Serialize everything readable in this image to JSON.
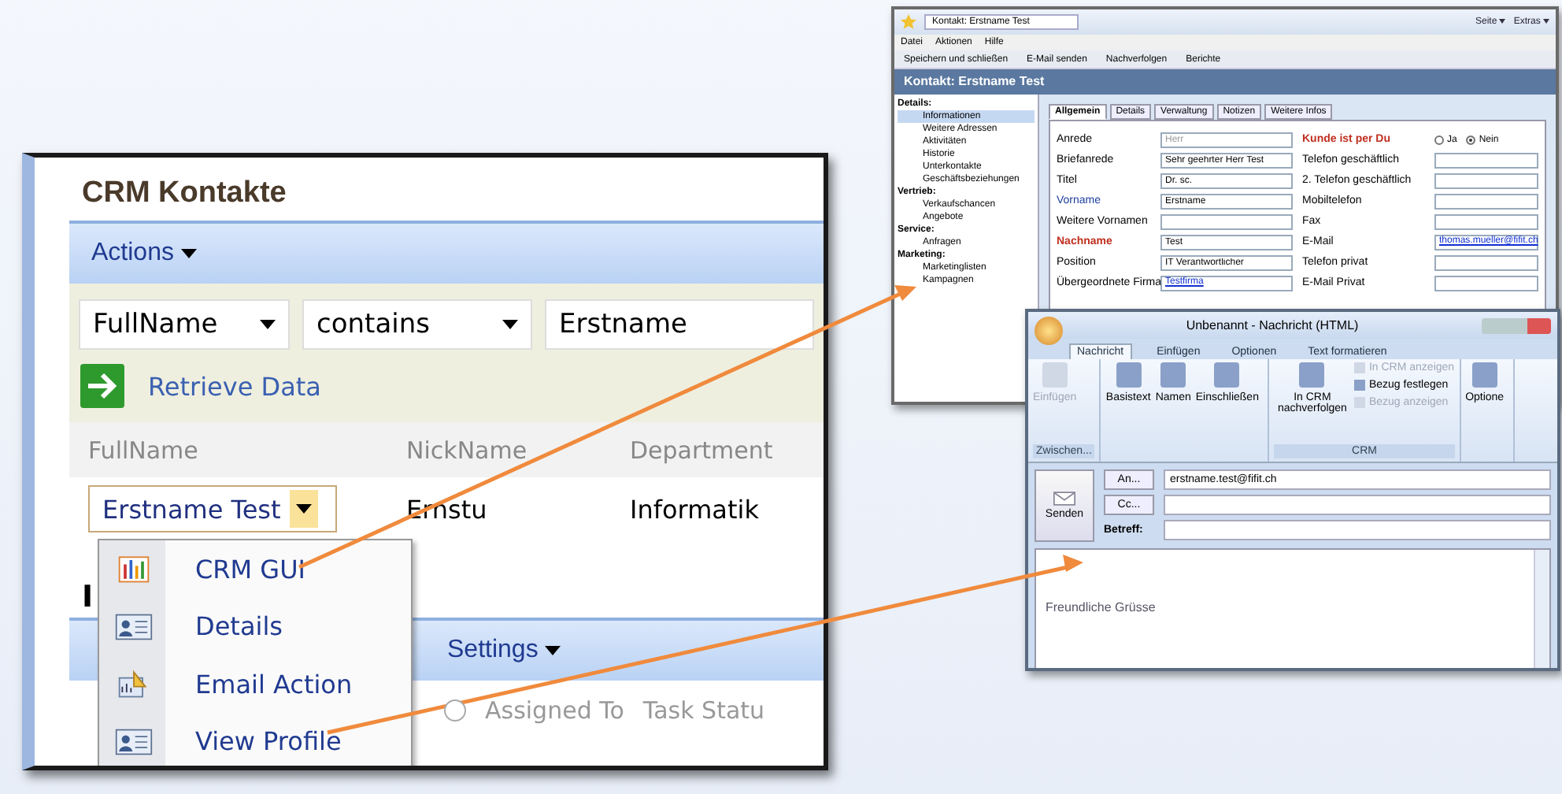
{
  "crm_panel": {
    "title": "CRM Kontakte",
    "actions_menu": "Actions",
    "filter": {
      "field": "FullName",
      "operator": "contains",
      "value": "Erstname"
    },
    "retrieve_link": "Retrieve Data",
    "table": {
      "columns": [
        "FullName",
        "NickName",
        "Department"
      ],
      "rows": [
        {
          "cells": [
            "Erstname Test",
            "Ernstu",
            "Informatik"
          ]
        }
      ]
    },
    "context_menu": [
      {
        "label": "CRM GUI",
        "kind": "chart"
      },
      {
        "label": "Details",
        "kind": "card"
      },
      {
        "label": "Email Action",
        "kind": "email"
      },
      {
        "label": "View Profile",
        "kind": "card"
      }
    ],
    "lower_section": {
      "heading": "I",
      "settings_menu": "Settings",
      "row_selector": {
        "selected": false
      },
      "columns": [
        "Assigned To",
        "Task Statu"
      ]
    }
  },
  "contact_window": {
    "title": "Kontakt: Erstname Test",
    "browser_buttons": [
      "Seite",
      "Extras"
    ],
    "menu": [
      "Datei",
      "Aktionen",
      "Hilfe"
    ],
    "toolbar": [
      "Speichern und schließen",
      "E-Mail senden",
      "Nachverfolgen",
      "Berichte"
    ],
    "header": "Kontakt: Erstname Test",
    "nav": [
      {
        "section": "Details:",
        "items": [
          {
            "label": "Informationen",
            "selected": true
          },
          {
            "label": "Weitere Adressen",
            "selected": false
          },
          {
            "label": "Aktivitäten",
            "selected": false
          },
          {
            "label": "Historie",
            "selected": false
          },
          {
            "label": "Unterkontakte",
            "selected": false
          },
          {
            "label": "Geschäftsbeziehungen",
            "selected": false
          }
        ]
      },
      {
        "section": "Vertrieb:",
        "items": [
          {
            "label": "Verkaufschancen",
            "selected": false
          },
          {
            "label": "Angebote",
            "selected": false
          }
        ]
      },
      {
        "section": "Service:",
        "items": [
          {
            "label": "Anfragen",
            "selected": false
          }
        ]
      },
      {
        "section": "Marketing:",
        "items": [
          {
            "label": "Marketinglisten",
            "selected": false
          },
          {
            "label": "Kampagnen",
            "selected": false
          }
        ]
      }
    ],
    "tabs": [
      {
        "label": "Allgemein",
        "selected": true
      },
      {
        "label": "Details",
        "selected": false
      },
      {
        "label": "Verwaltung",
        "selected": false
      },
      {
        "label": "Notizen",
        "selected": false
      },
      {
        "label": "Weitere Infos",
        "selected": false
      }
    ],
    "left_fields": [
      {
        "label": "Anrede",
        "placeholder": "Herr",
        "kind": "text",
        "color": "#000000"
      },
      {
        "label": "Briefanrede",
        "value": "Sehr geehrter Herr Test",
        "kind": "text",
        "color": "#000000"
      },
      {
        "label": "Titel",
        "value": "Dr. sc.",
        "kind": "text",
        "color": "#000000"
      },
      {
        "label": "Vorname",
        "value": "Erstname",
        "kind": "text",
        "color": "#2040a0"
      },
      {
        "label": "Weitere Vornamen",
        "kind": "text",
        "color": "#000000"
      },
      {
        "label": "Nachname",
        "value": "Test",
        "kind": "text",
        "color": "#c03020"
      },
      {
        "label": "Position",
        "value": "IT Verantwortlicher",
        "kind": "text",
        "color": "#000000"
      },
      {
        "label": "Übergeordnete Firma",
        "value": "Testfirma",
        "kind": "lookup",
        "color": "#000000"
      }
    ],
    "right_fields": [
      {
        "label": "Kunde ist per Du",
        "kind": "radio",
        "color": "#c03020",
        "options": [
          {
            "label": "Ja",
            "selected": false
          },
          {
            "label": "Nein",
            "selected": true
          }
        ]
      },
      {
        "label": "Telefon geschäftlich",
        "kind": "text",
        "color": "#000000"
      },
      {
        "label": "2. Telefon geschäftlich",
        "kind": "text",
        "color": "#000000"
      },
      {
        "label": "Mobiltelefon",
        "kind": "text",
        "color": "#000000"
      },
      {
        "label": "Fax",
        "kind": "text",
        "color": "#000000"
      },
      {
        "label": "E-Mail",
        "value": "thomas.mueller@fifit.ch",
        "kind": "link",
        "color": "#000000"
      },
      {
        "label": "Telefon privat",
        "kind": "text",
        "color": "#000000"
      },
      {
        "label": "E-Mail Privat",
        "kind": "text",
        "color": "#000000"
      }
    ]
  },
  "email_window": {
    "title": "Unbenannt - Nachricht (HTML)",
    "tabs": [
      {
        "label": "Nachricht",
        "selected": true
      },
      {
        "label": "Einfügen",
        "selected": false
      },
      {
        "label": "Optionen",
        "selected": false
      },
      {
        "label": "Text formatieren",
        "selected": false
      }
    ],
    "ribbon_groups": [
      {
        "label": "Zwischen...",
        "buttons": [
          {
            "label": "Einfügen",
            "kind": "large",
            "disabled": true
          }
        ]
      },
      {
        "buttons": [
          {
            "label": "Basistext",
            "kind": "large",
            "disabled": false
          },
          {
            "label": "Namen",
            "kind": "large",
            "disabled": false
          },
          {
            "label": "Einschließen",
            "kind": "large",
            "disabled": false
          }
        ]
      },
      {
        "label": "CRM",
        "buttons": [
          {
            "label": "In CRM nachverfolgen",
            "kind": "large",
            "disabled": false
          },
          {
            "label": "In CRM anzeigen",
            "kind": "small",
            "disabled": true
          },
          {
            "label": "Bezug festlegen",
            "kind": "small",
            "disabled": false
          },
          {
            "label": "Bezug anzeigen",
            "kind": "small",
            "disabled": true
          }
        ]
      },
      {
        "buttons": [
          {
            "label": "Optione",
            "kind": "large",
            "disabled": false
          }
        ]
      }
    ],
    "send_button": "Senden",
    "to_button": "An...",
    "to_value": "erstname.test@fifit.ch",
    "cc_button": "Cc...",
    "subject_label": "Betreff:",
    "body": "Freundliche Grüsse"
  }
}
